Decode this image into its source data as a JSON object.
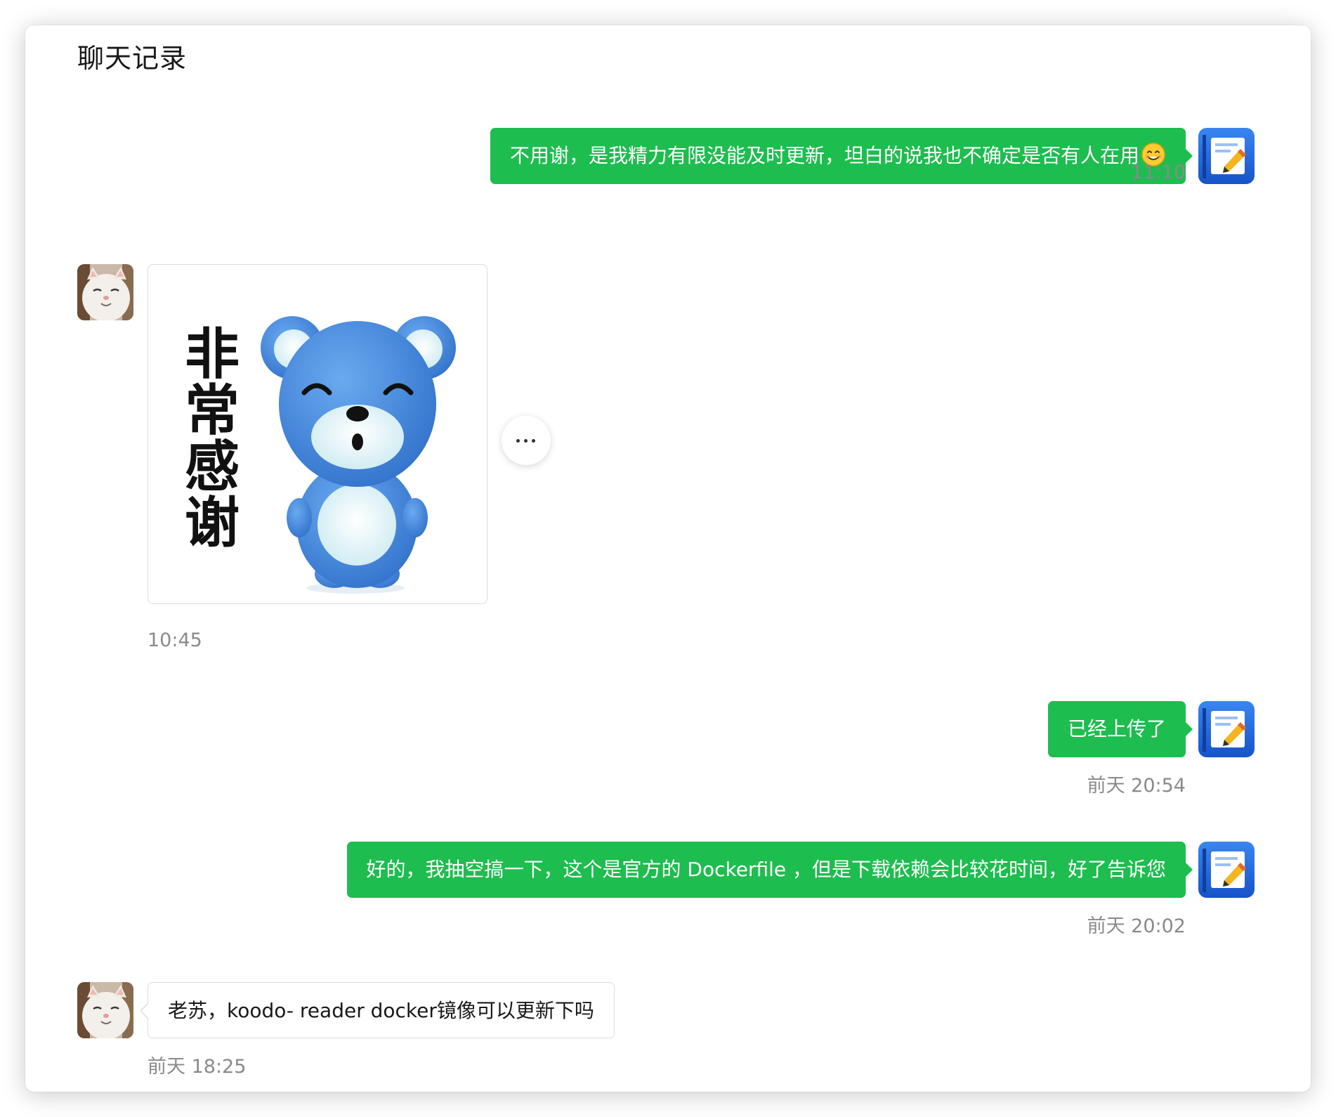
{
  "window": {
    "title": "聊天记录"
  },
  "messages": [
    {
      "sender": "me",
      "text": "不用谢，是我精力有限没能及时更新，坦白的说我也不确定是否有人在用",
      "emoji": "smiling-face-emoji",
      "time": "11:10"
    },
    {
      "sender": "them",
      "type": "sticker",
      "sticker_text": "非常感谢",
      "time": "10:45"
    },
    {
      "sender": "me",
      "text": "已经上传了",
      "time": "前天 20:54"
    },
    {
      "sender": "me",
      "text": "好的，我抽空搞一下，这个是官方的 Dockerfile ，但是下载依赖会比较花时间，好了告诉您",
      "time": "前天 20:02"
    },
    {
      "sender": "them",
      "text": "老苏，koodo- reader docker镜像可以更新下吗",
      "time": "前天 18:25"
    }
  ],
  "icons": {
    "my_avatar": "notes-app-icon",
    "their_avatar": "cat-photo",
    "more": "more-dots-icon"
  },
  "colors": {
    "my_bubble": "#1ebd4f",
    "their_bubble": "#ffffff",
    "timestamp": "#8a8a8a"
  }
}
